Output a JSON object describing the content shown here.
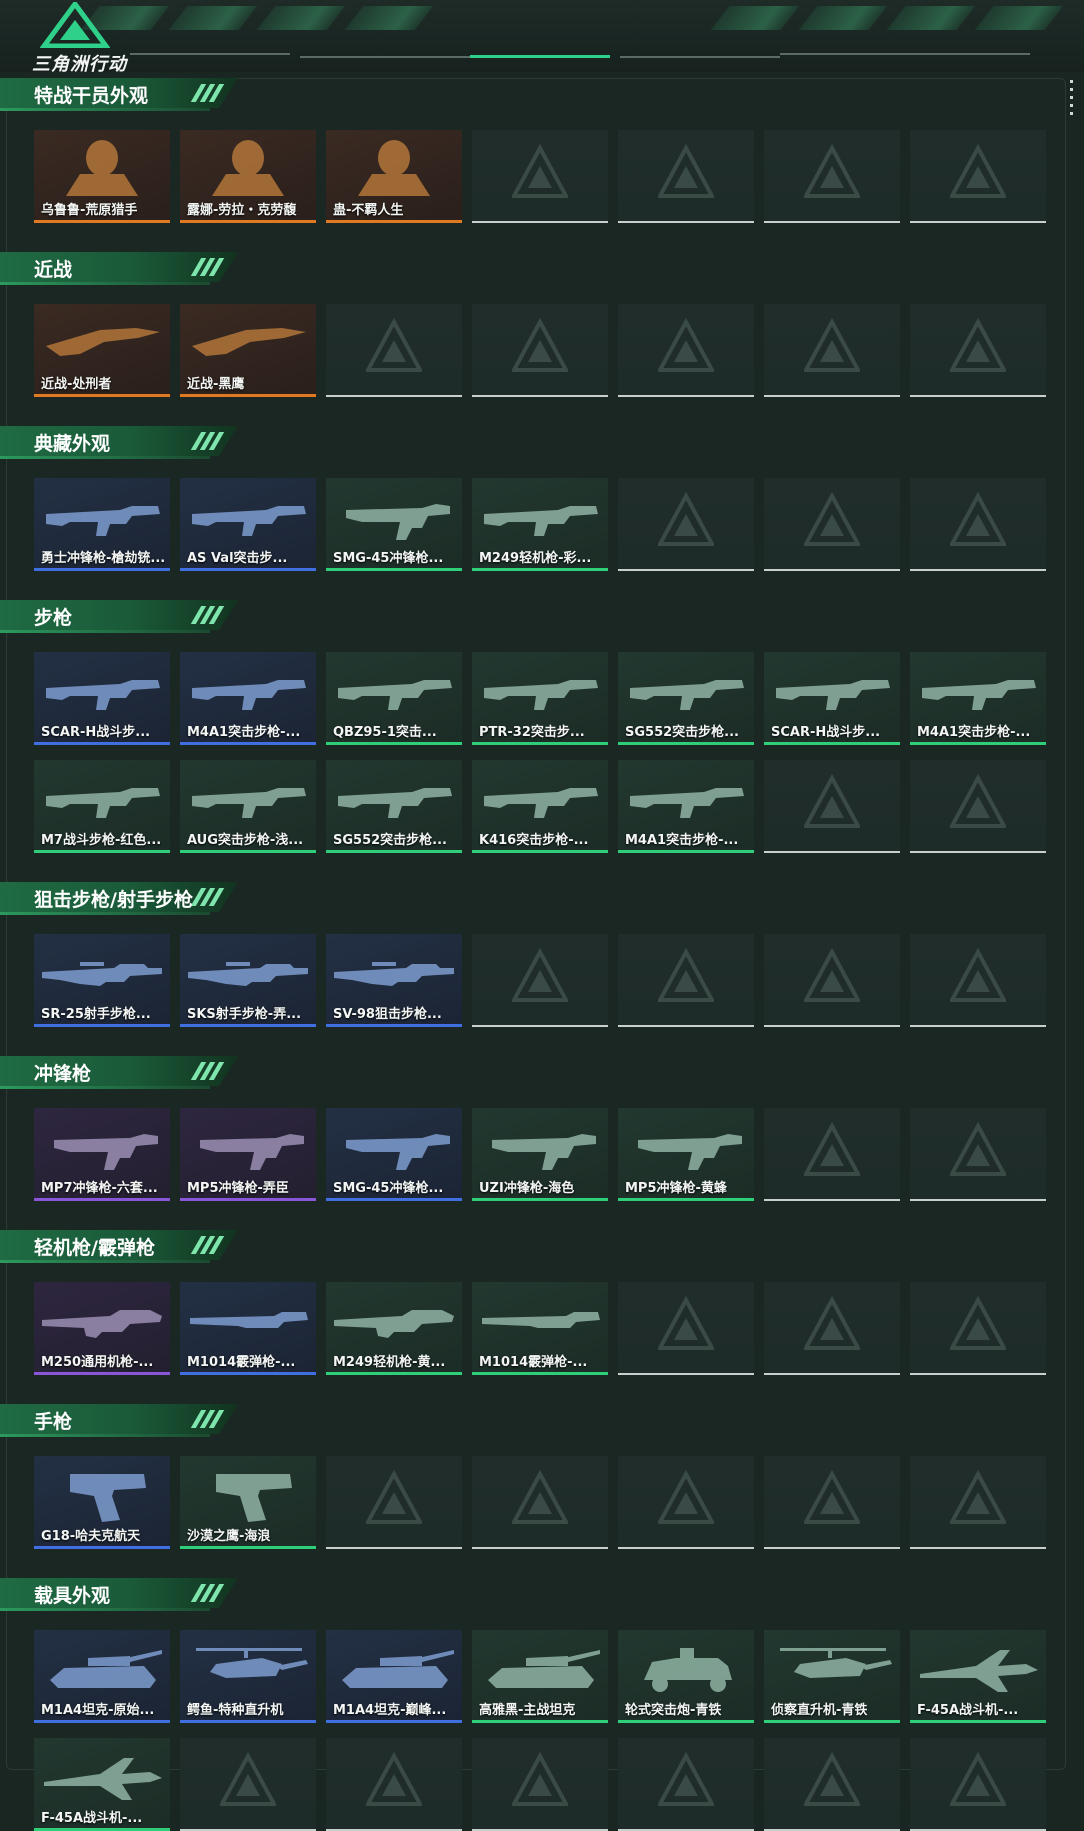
{
  "logo": {
    "text": "三角洲行动"
  },
  "colors": {
    "orange": "#e07a22",
    "purple": "#8a55d6",
    "blue": "#3f6fe0",
    "green": "#2fcf7a",
    "empty": "#c8cfcc",
    "accent": "#2fd08a"
  },
  "sections": [
    {
      "title": "特战干员外观",
      "rows": [
        [
          {
            "name": "乌鲁鲁-荒原猎手",
            "rarity": "orange",
            "icon": "operator-portrait"
          },
          {
            "name": "露娜-劳拉・克劳馥",
            "rarity": "orange",
            "icon": "operator-portrait"
          },
          {
            "name": "蛊-不羁人生",
            "rarity": "orange",
            "icon": "operator-portrait"
          },
          null,
          null,
          null,
          null
        ]
      ]
    },
    {
      "title": "近战",
      "rows": [
        [
          {
            "name": "近战-处刑者",
            "rarity": "orange",
            "icon": "knife"
          },
          {
            "name": "近战-黑鹰",
            "rarity": "orange",
            "icon": "knife"
          },
          null,
          null,
          null,
          null,
          null
        ]
      ]
    },
    {
      "title": "典藏外观",
      "rows": [
        [
          {
            "name": "勇士冲锋枪-槍劫铳...",
            "rarity": "blue",
            "icon": "rifle"
          },
          {
            "name": "AS Val突击步...",
            "rarity": "blue",
            "icon": "rifle"
          },
          {
            "name": "SMG-45冲锋枪...",
            "rarity": "green",
            "icon": "smg"
          },
          {
            "name": "M249轻机枪-彩...",
            "rarity": "green",
            "icon": "rifle"
          },
          null,
          null,
          null
        ]
      ]
    },
    {
      "title": "步枪",
      "rows": [
        [
          {
            "name": "SCAR-H战斗步...",
            "rarity": "blue",
            "icon": "rifle"
          },
          {
            "name": "M4A1突击步枪-...",
            "rarity": "blue",
            "icon": "rifle"
          },
          {
            "name": "QBZ95-1突击...",
            "rarity": "green",
            "icon": "rifle"
          },
          {
            "name": "PTR-32突击步...",
            "rarity": "green",
            "icon": "rifle"
          },
          {
            "name": "SG552突击步枪...",
            "rarity": "green",
            "icon": "rifle"
          },
          {
            "name": "SCAR-H战斗步...",
            "rarity": "green",
            "icon": "rifle"
          },
          {
            "name": "M4A1突击步枪-...",
            "rarity": "green",
            "icon": "rifle"
          }
        ],
        [
          {
            "name": "M7战斗步枪-红色...",
            "rarity": "green",
            "icon": "rifle"
          },
          {
            "name": "AUG突击步枪-浅...",
            "rarity": "green",
            "icon": "rifle"
          },
          {
            "name": "SG552突击步枪...",
            "rarity": "green",
            "icon": "rifle"
          },
          {
            "name": "K416突击步枪-...",
            "rarity": "green",
            "icon": "rifle"
          },
          {
            "name": "M4A1突击步枪-...",
            "rarity": "green",
            "icon": "rifle"
          },
          null,
          null
        ]
      ]
    },
    {
      "title": "狙击步枪/射手步枪",
      "rows": [
        [
          {
            "name": "SR-25射手步枪...",
            "rarity": "blue",
            "icon": "sniper"
          },
          {
            "name": "SKS射手步枪-弄...",
            "rarity": "blue",
            "icon": "sniper"
          },
          {
            "name": "SV-98狙击步枪...",
            "rarity": "blue",
            "icon": "sniper"
          },
          null,
          null,
          null,
          null
        ]
      ]
    },
    {
      "title": "冲锋枪",
      "rows": [
        [
          {
            "name": "MP7冲锋枪-六套...",
            "rarity": "purple",
            "icon": "smg"
          },
          {
            "name": "MP5冲锋枪-弄臣",
            "rarity": "purple",
            "icon": "smg"
          },
          {
            "name": "SMG-45冲锋枪...",
            "rarity": "blue",
            "icon": "smg"
          },
          {
            "name": "UZI冲锋枪-海色",
            "rarity": "green",
            "icon": "smg"
          },
          {
            "name": "MP5冲锋枪-黄蜂",
            "rarity": "green",
            "icon": "smg"
          },
          null,
          null
        ]
      ]
    },
    {
      "title": "轻机枪/霰弹枪",
      "rows": [
        [
          {
            "name": "M250通用机枪-...",
            "rarity": "purple",
            "icon": "lmg"
          },
          {
            "name": "M1014霰弹枪-...",
            "rarity": "blue",
            "icon": "shotgun"
          },
          {
            "name": "M249轻机枪-黄...",
            "rarity": "green",
            "icon": "lmg"
          },
          {
            "name": "M1014霰弹枪-...",
            "rarity": "green",
            "icon": "shotgun"
          },
          null,
          null,
          null
        ]
      ]
    },
    {
      "title": "手枪",
      "rows": [
        [
          {
            "name": "G18-哈夫克航天",
            "rarity": "blue",
            "icon": "pistol"
          },
          {
            "name": "沙漠之鹰-海浪",
            "rarity": "green",
            "icon": "pistol"
          },
          null,
          null,
          null,
          null,
          null
        ]
      ]
    },
    {
      "title": "载具外观",
      "rows": [
        [
          {
            "name": "M1A4坦克-原始...",
            "rarity": "blue",
            "icon": "tank"
          },
          {
            "name": "鳄鱼-特种直升机",
            "rarity": "blue",
            "icon": "helicopter"
          },
          {
            "name": "M1A4坦克-巅峰...",
            "rarity": "blue",
            "icon": "tank"
          },
          {
            "name": "高雅黑-主战坦克",
            "rarity": "green",
            "icon": "tank"
          },
          {
            "name": "轮式突击炮-青铁",
            "rarity": "green",
            "icon": "armored-car"
          },
          {
            "name": "侦察直升机-青铁",
            "rarity": "green",
            "icon": "helicopter"
          },
          {
            "name": "F-45A战斗机-...",
            "rarity": "green",
            "icon": "jet"
          }
        ],
        [
          {
            "name": "F-45A战斗机-...",
            "rarity": "green",
            "icon": "jet"
          },
          null,
          null,
          null,
          null,
          null,
          null
        ]
      ]
    }
  ]
}
